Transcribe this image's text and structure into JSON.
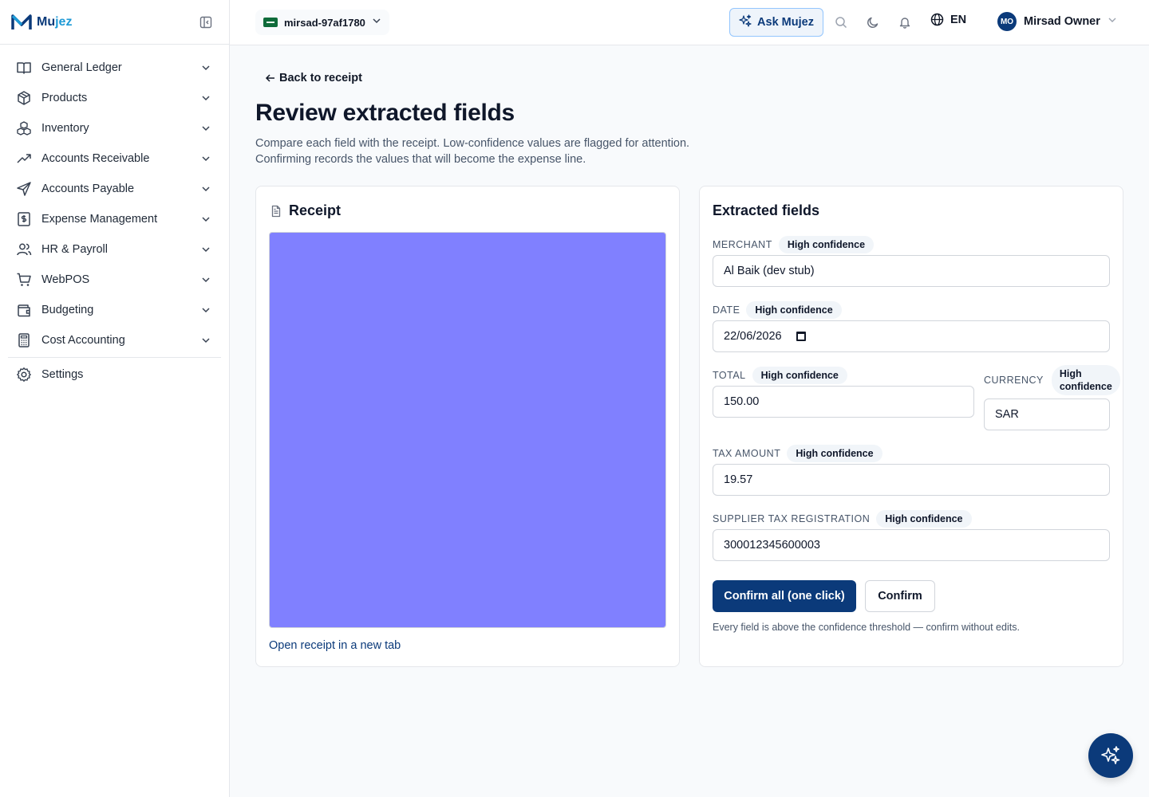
{
  "brand": {
    "name_main": "Mu",
    "name_accent": "jez"
  },
  "sidebar": {
    "items": [
      {
        "label": "General Ledger",
        "icon": "book-open-icon"
      },
      {
        "label": "Products",
        "icon": "package-icon"
      },
      {
        "label": "Inventory",
        "icon": "boxes-icon"
      },
      {
        "label": "Accounts Receivable",
        "icon": "trending-up-icon"
      },
      {
        "label": "Accounts Payable",
        "icon": "send-icon"
      },
      {
        "label": "Expense Management",
        "icon": "receipt-dollar-icon"
      },
      {
        "label": "HR & Payroll",
        "icon": "users-icon"
      },
      {
        "label": "WebPOS",
        "icon": "shopping-cart-icon"
      },
      {
        "label": "Budgeting",
        "icon": "wallet-icon"
      },
      {
        "label": "Cost Accounting",
        "icon": "calculator-icon"
      }
    ],
    "settings": {
      "label": "Settings",
      "icon": "gear-icon"
    }
  },
  "topbar": {
    "org_name": "mirsad-97af1780",
    "ask_label": "Ask Mujez",
    "lang_label": "EN",
    "user_initials": "MO",
    "user_name": "Mirsad Owner"
  },
  "main": {
    "back_label": "Back to receipt",
    "title": "Review extracted fields",
    "description_line1": "Compare each field with the receipt. Low-confidence values are flagged for attention.",
    "description_line2": "Confirming records the values that will become the expense line."
  },
  "receipt": {
    "title": "Receipt",
    "open_link": "Open receipt in a new tab",
    "image_color": "#8080ff"
  },
  "fields": {
    "title": "Extracted fields",
    "merchant": {
      "label": "Merchant",
      "badge": "High confidence",
      "value": "Al Baik (dev stub)"
    },
    "date": {
      "label": "Date",
      "badge": "High confidence",
      "value": "22/06/2026"
    },
    "total": {
      "label": "Total",
      "badge": "High confidence",
      "value": "150.00"
    },
    "currency": {
      "label": "Currency",
      "badge": "High confidence",
      "value": "SAR"
    },
    "tax_amount": {
      "label": "Tax Amount",
      "badge": "High confidence",
      "value": "19.57"
    },
    "supplier_tax": {
      "label": "Supplier Tax Registration",
      "badge": "High confidence",
      "value": "300012345600003"
    },
    "confirm_all_label": "Confirm all (one click)",
    "confirm_label": "Confirm",
    "hint": "Every field is above the confidence threshold — confirm without edits."
  },
  "colors": {
    "primary": "#0b3a7a",
    "accent": "#1e9ad6",
    "badge_bg": "#f1f5f9"
  }
}
